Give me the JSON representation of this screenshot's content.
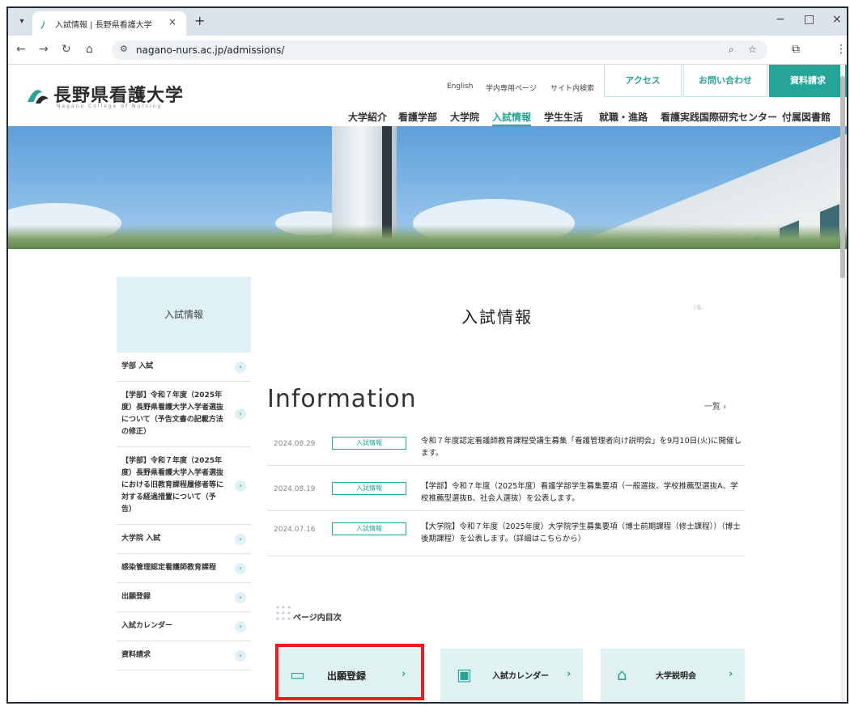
{
  "browser": {
    "tab_title": "入試情報 | 長野県看護大学",
    "new_tab": "+",
    "url": "nagano-nurs.ac.jp/admissions/",
    "window_controls": [
      "−",
      "□",
      "×"
    ]
  },
  "site": {
    "logo_text": "長野県看護大学",
    "logo_sub": "Nagano College of Nursing",
    "utility_links": [
      "English",
      "学内専用ページ",
      "サイト内検索"
    ],
    "header_buttons": [
      "アクセス",
      "お問い合わせ",
      "資料請求"
    ],
    "global_nav": [
      "大学紹介",
      "看護学部",
      "大学院",
      "入試情報",
      "学生生活",
      "就職・進路",
      "看護実践国際研究センター",
      "付属図書館"
    ],
    "active_nav": "入試情報"
  },
  "sidebar": {
    "heading": "入試情報",
    "items": [
      "学部 入試",
      "【学部】令和７年度（2025年度）長野県看護大学入学者選抜について（予告文書の記載方法の修正）",
      "【学部】令和７年度（2025年度）長野県看護大学入学者選抜における旧教育課程履修者等に対する経過措置について（予告）",
      "大学院 入試",
      "感染管理認定看護師教育課程",
      "出願登録",
      "入試カレンダー",
      "資料請求"
    ]
  },
  "main": {
    "page_title": "入試情報",
    "info_heading": "Information",
    "more_link": "一覧 ›",
    "news": [
      {
        "date": "2024.08.29",
        "tag": "入試情報",
        "text": "令和７年度認定看護師教育課程受講生募集「看護管理者向け説明会」を9月10日(火)に開催します。"
      },
      {
        "date": "2024.08.19",
        "tag": "入試情報",
        "text": "【学部】令和７年度（2025年度）看護学部学生募集要項（一般選抜、学校推薦型選抜A、学校推薦型選抜B、社会人選抜）を公表します。"
      },
      {
        "date": "2024.07.16",
        "tag": "入試情報",
        "text": "【大学院】令和７年度（2025年度）大学院学生募集要項（博士前期課程（修士課程））（博士後期課程）を公表します。（詳細はこちらから）"
      }
    ],
    "toc_label": "ページ内目次",
    "cta": [
      {
        "label": "出願登録",
        "icon": "chat-icon"
      },
      {
        "label": "入試カレンダー",
        "icon": "calendar-icon"
      },
      {
        "label": "大学説明会",
        "icon": "building-icon"
      }
    ]
  },
  "colors": {
    "accent": "#25a595",
    "highlight": "#ef1c1c",
    "pale": "#dff1f4"
  }
}
